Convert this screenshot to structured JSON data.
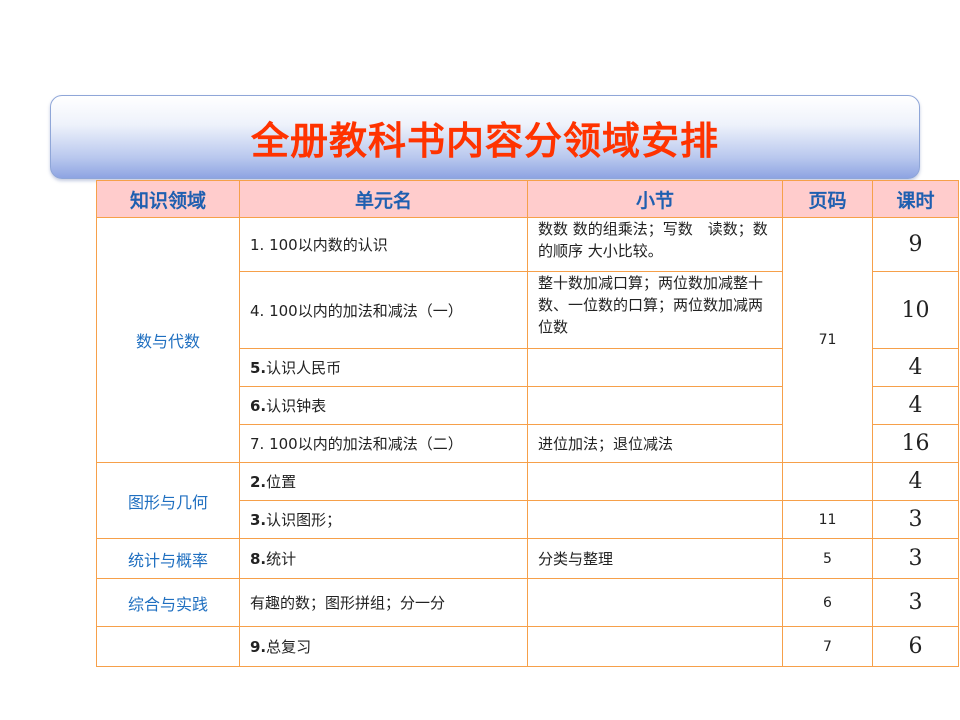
{
  "title": "全册教科书内容分领域安排",
  "headers": [
    "知识领域",
    "单元名",
    "小节",
    "页码",
    "课时"
  ],
  "rows": [
    {
      "domain": "数与代数",
      "unit": "1. 100以内数的认识",
      "section": "数数 数的组乘法；写数　读数；数的顺序 大小比较。",
      "pages": "71",
      "hours": "9"
    },
    {
      "unit": "4. 100以内的加法和减法（一）",
      "section": "整十数加减口算；两位数加减整十数、一位数的口算；两位数加减两位数",
      "hours": "10"
    },
    {
      "unit_num": "5.",
      "unit_text": "认识人民币",
      "section": "",
      "hours": "4"
    },
    {
      "unit_num": "6.",
      "unit_text": "认识钟表",
      "section": "",
      "hours": "4"
    },
    {
      "unit": "7. 100以内的加法和减法（二）",
      "section": "进位加法；退位减法",
      "hours": "16"
    },
    {
      "domain": "图形与几何",
      "unit_num": "2.",
      "unit_text": "位置",
      "section": "",
      "pages": "",
      "hours": "4"
    },
    {
      "unit_num": "3.",
      "unit_text": "认识图形；",
      "section": "",
      "pages": "11",
      "hours": "3"
    },
    {
      "domain": "统计与概率",
      "unit_num": "8.",
      "unit_text": "统计",
      "section": "分类与整理",
      "pages": "5",
      "hours": "3"
    },
    {
      "domain": "综合与实践",
      "unit": "有趣的数；图形拼组；分一分",
      "section": "",
      "pages": "6",
      "hours": "3"
    },
    {
      "domain": "",
      "unit_num": "9.",
      "unit_text": "总复习",
      "section": "",
      "pages": "7",
      "hours": "6"
    }
  ]
}
